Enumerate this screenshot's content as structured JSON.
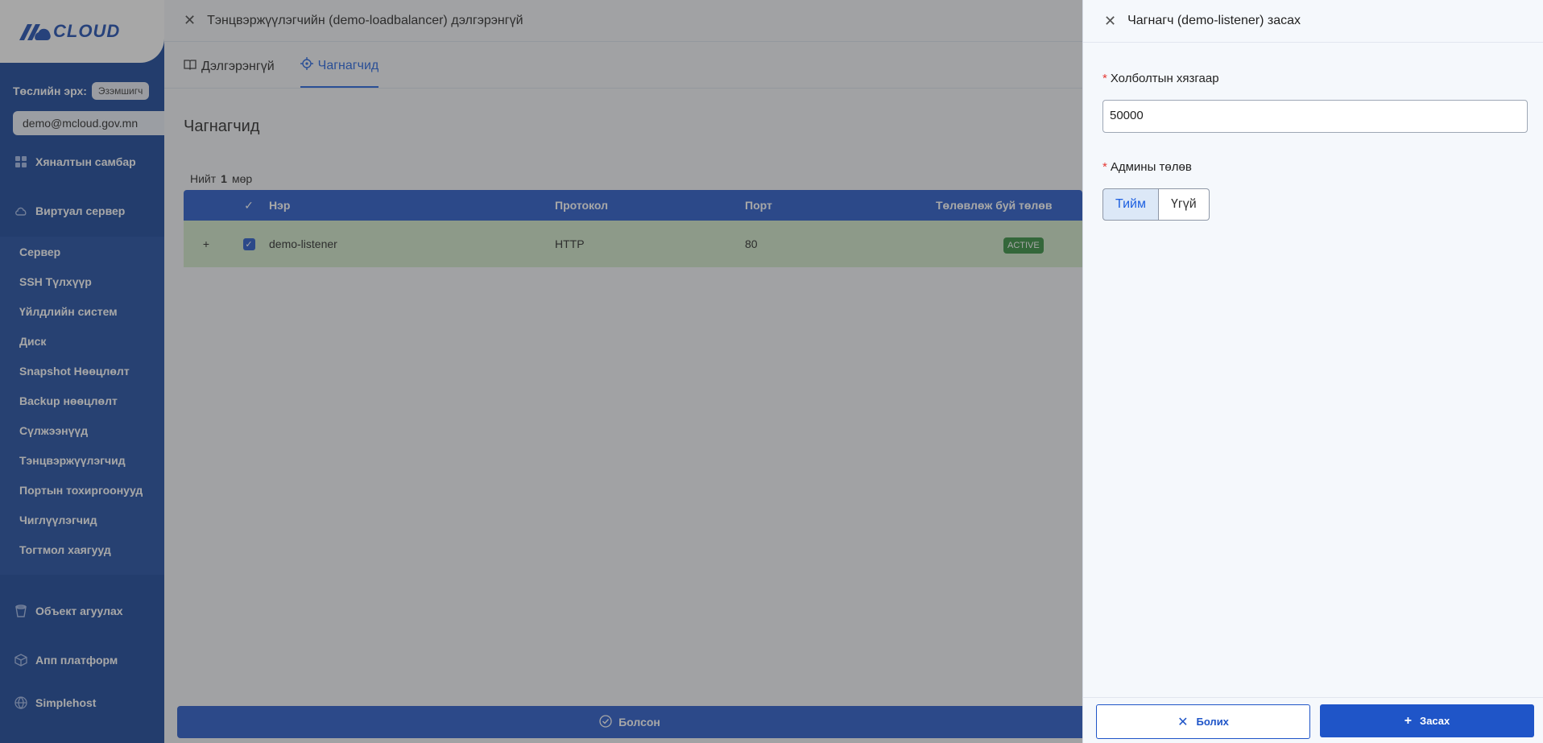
{
  "sidebar": {
    "logo_text": "CLOUD",
    "role_label": "Төслийн эрх:",
    "role_value": "Эзэмшигч",
    "email": "demo@mcloud.gov.mn",
    "nav_top": [
      {
        "label": "Хяналтын самбар",
        "icon": "dashboard-icon"
      },
      {
        "label": "Виртуал сервер",
        "icon": "cloud-icon"
      }
    ],
    "sub_items": [
      "Сервер",
      "SSH Түлхүүр",
      "Үйлдлийн систем",
      "Диск",
      "Snapshot Нөөцлөлт",
      "Backup нөөцлөлт",
      "Сүлжээнүүд",
      "Тэнцвэржүүлэгчид",
      "Портын тохиргоонууд",
      "Чиглүүлэгчид",
      "Тогтмол хаягууд"
    ],
    "nav_bottom": [
      {
        "label": "Объект агуулах",
        "icon": "bucket-icon"
      },
      {
        "label": "Апп платформ",
        "icon": "box-icon"
      },
      {
        "label": "Simplehost",
        "icon": "globe-icon"
      }
    ]
  },
  "main": {
    "title": "Тэнцвэржүүлэгчийн (demo-loadbalancer) дэлгэрэнгүй",
    "tabs": [
      {
        "label": "Дэлгэрэнгүй",
        "active": false
      },
      {
        "label": "Чагнагчид",
        "active": true
      }
    ],
    "section_title": "Чагнагчид",
    "total_prefix": "Нийт",
    "total_count": "1",
    "total_suffix": "мөр",
    "table": {
      "headers": {
        "name": "Нэр",
        "protocol": "Протокол",
        "port": "Порт",
        "status": "Төлөвлөж буй төлөв"
      },
      "rows": [
        {
          "name": "demo-listener",
          "protocol": "HTTP",
          "port": "80",
          "status": "ACTIVE"
        }
      ]
    },
    "done_label": "Болсон"
  },
  "drawer": {
    "title": "Чагнагч (demo-listener) засах",
    "field1_label": "Холболтын хязгаар",
    "field1_value": "50000",
    "field2_label": "Админы төлөв",
    "options": [
      "Тийм",
      "Үгүй"
    ],
    "selected": "Тийм",
    "cancel_label": "Болих",
    "submit_label": "Засах"
  },
  "colors": {
    "sidebar_bg": "#0f3e96",
    "primary": "#1f55c8",
    "row_selected": "#cfe8c9",
    "active_badge": "#2e8b3a"
  }
}
